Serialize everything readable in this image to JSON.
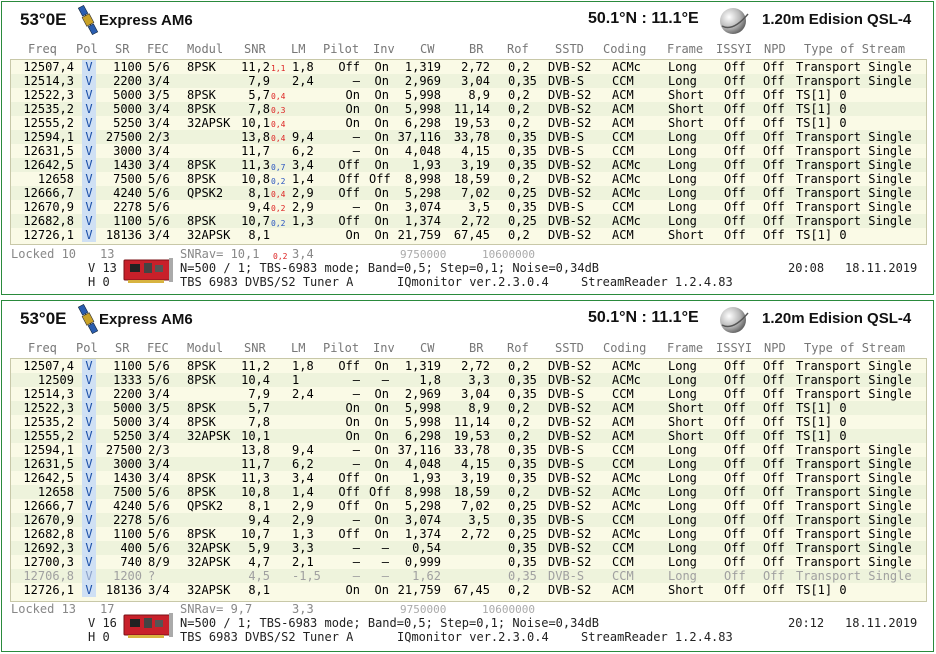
{
  "colors": {
    "border": "#2a8a3c",
    "table_bg": "#fafae6",
    "row_alt": "#eef3dc",
    "pol_bg": "#cfe0f4",
    "up_mark": "#d22222",
    "down_mark": "#2a55c0"
  },
  "icons": {
    "satellite": "satellite-icon",
    "globe": "globe-icon",
    "tuner_card": "tuner-card-icon"
  },
  "columns": [
    "Freq",
    "Pol",
    "SR",
    "FEC",
    "Modul",
    "SNR",
    "LM",
    "Pilot",
    "Inv",
    "CW",
    "BR",
    "Rof",
    "SSTD",
    "Coding",
    "Frame",
    "ISSYI",
    "NPD",
    "Type of Stream"
  ],
  "panels": [
    {
      "position": "53°0E",
      "satellite": "Express AM6",
      "location": "50.1°N : 11.1°E",
      "dish": "1.20m Edision QSL-4",
      "rows": [
        {
          "freq": "12507,4",
          "pol": "V",
          "sr": "1100",
          "fec": "5/6",
          "modul": "8PSK",
          "snr": "11,2",
          "mark": "1,1",
          "mdir": "up",
          "lm": "1,8",
          "pilot": "Off",
          "inv": "On",
          "cw": "1,319",
          "br": "2,72",
          "rof": "0,2",
          "sstd": "DVB-S2",
          "coding": "ACMc",
          "frame": "Long",
          "issyi": "Off",
          "npd": "Off",
          "type": "Transport Single"
        },
        {
          "freq": "12514,3",
          "pol": "V",
          "sr": "2200",
          "fec": "3/4",
          "modul": "",
          "snr": "7,9",
          "mark": "",
          "mdir": "",
          "lm": "2,4",
          "pilot": "–",
          "inv": "On",
          "cw": "2,969",
          "br": "3,04",
          "rof": "0,35",
          "sstd": "DVB-S",
          "coding": "CCM",
          "frame": "Long",
          "issyi": "Off",
          "npd": "Off",
          "type": "Transport Single"
        },
        {
          "freq": "12522,3",
          "pol": "V",
          "sr": "5000",
          "fec": "3/5",
          "modul": "8PSK",
          "snr": "5,7",
          "mark": "0,4",
          "mdir": "up",
          "lm": "",
          "pilot": "On",
          "inv": "On",
          "cw": "5,998",
          "br": "8,9",
          "rof": "0,2",
          "sstd": "DVB-S2",
          "coding": "ACM",
          "frame": "Short",
          "issyi": "Off",
          "npd": "Off",
          "type": "TS[1] 0"
        },
        {
          "freq": "12535,2",
          "pol": "V",
          "sr": "5000",
          "fec": "3/4",
          "modul": "8PSK",
          "snr": "7,8",
          "mark": "0,3",
          "mdir": "up",
          "lm": "",
          "pilot": "On",
          "inv": "On",
          "cw": "5,998",
          "br": "11,14",
          "rof": "0,2",
          "sstd": "DVB-S2",
          "coding": "ACM",
          "frame": "Short",
          "issyi": "Off",
          "npd": "Off",
          "type": "TS[1] 0"
        },
        {
          "freq": "12555,2",
          "pol": "V",
          "sr": "5250",
          "fec": "3/4",
          "modul": "32APSK",
          "snr": "10,1",
          "mark": "0,4",
          "mdir": "up",
          "lm": "",
          "pilot": "On",
          "inv": "On",
          "cw": "6,298",
          "br": "19,53",
          "rof": "0,2",
          "sstd": "DVB-S2",
          "coding": "ACM",
          "frame": "Short",
          "issyi": "Off",
          "npd": "Off",
          "type": "TS[1] 0"
        },
        {
          "freq": "12594,1",
          "pol": "V",
          "sr": "27500",
          "fec": "2/3",
          "modul": "",
          "snr": "13,8",
          "mark": "0,4",
          "mdir": "up",
          "lm": "9,4",
          "pilot": "–",
          "inv": "On",
          "cw": "37,116",
          "br": "33,78",
          "rof": "0,35",
          "sstd": "DVB-S",
          "coding": "CCM",
          "frame": "Long",
          "issyi": "Off",
          "npd": "Off",
          "type": "Transport Single"
        },
        {
          "freq": "12631,5",
          "pol": "V",
          "sr": "3000",
          "fec": "3/4",
          "modul": "",
          "snr": "11,7",
          "mark": "",
          "mdir": "",
          "lm": "6,2",
          "pilot": "–",
          "inv": "On",
          "cw": "4,048",
          "br": "4,15",
          "rof": "0,35",
          "sstd": "DVB-S",
          "coding": "CCM",
          "frame": "Long",
          "issyi": "Off",
          "npd": "Off",
          "type": "Transport Single"
        },
        {
          "freq": "12642,5",
          "pol": "V",
          "sr": "1430",
          "fec": "3/4",
          "modul": "8PSK",
          "snr": "11,3",
          "mark": "0,7",
          "mdir": "dn",
          "lm": "3,4",
          "pilot": "Off",
          "inv": "On",
          "cw": "1,93",
          "br": "3,19",
          "rof": "0,35",
          "sstd": "DVB-S2",
          "coding": "ACMc",
          "frame": "Long",
          "issyi": "Off",
          "npd": "Off",
          "type": "Transport Single"
        },
        {
          "freq": "12658",
          "pol": "V",
          "sr": "7500",
          "fec": "5/6",
          "modul": "8PSK",
          "snr": "10,8",
          "mark": "0,2",
          "mdir": "dn",
          "lm": "1,4",
          "pilot": "Off",
          "inv": "Off",
          "cw": "8,998",
          "br": "18,59",
          "rof": "0,2",
          "sstd": "DVB-S2",
          "coding": "ACMc",
          "frame": "Long",
          "issyi": "Off",
          "npd": "Off",
          "type": "Transport Single"
        },
        {
          "freq": "12666,7",
          "pol": "V",
          "sr": "4240",
          "fec": "5/6",
          "modul": "QPSK2",
          "snr": "8,1",
          "mark": "0,4",
          "mdir": "up",
          "lm": "2,9",
          "pilot": "Off",
          "inv": "On",
          "cw": "5,298",
          "br": "7,02",
          "rof": "0,25",
          "sstd": "DVB-S2",
          "coding": "ACMc",
          "frame": "Long",
          "issyi": "Off",
          "npd": "Off",
          "type": "Transport Single"
        },
        {
          "freq": "12670,9",
          "pol": "V",
          "sr": "2278",
          "fec": "5/6",
          "modul": "",
          "snr": "9,4",
          "mark": "0,2",
          "mdir": "up",
          "lm": "2,9",
          "pilot": "–",
          "inv": "On",
          "cw": "3,074",
          "br": "3,5",
          "rof": "0,35",
          "sstd": "DVB-S",
          "coding": "CCM",
          "frame": "Long",
          "issyi": "Off",
          "npd": "Off",
          "type": "Transport Single"
        },
        {
          "freq": "12682,8",
          "pol": "V",
          "sr": "1100",
          "fec": "5/6",
          "modul": "8PSK",
          "snr": "10,7",
          "mark": "0,2",
          "mdir": "dn",
          "lm": "1,3",
          "pilot": "Off",
          "inv": "On",
          "cw": "1,374",
          "br": "2,72",
          "rof": "0,25",
          "sstd": "DVB-S2",
          "coding": "ACMc",
          "frame": "Long",
          "issyi": "Off",
          "npd": "Off",
          "type": "Transport Single"
        },
        {
          "freq": "12726,1",
          "pol": "V",
          "sr": "18136",
          "fec": "3/4",
          "modul": "32APSK",
          "snr": "8,1",
          "mark": "",
          "mdir": "",
          "lm": "",
          "pilot": "On",
          "inv": "On",
          "cw": "21,759",
          "br": "67,45",
          "rof": "0,2",
          "sstd": "DVB-S2",
          "coding": "ACM",
          "frame": "Short",
          "issyi": "Off",
          "npd": "Off",
          "type": "TS[1] 0"
        }
      ],
      "footer": {
        "locked": "Locked 10",
        "count": "13",
        "snrav": "SNRav= 10,1",
        "snrav_mark": "0,2",
        "lmav": "3,4",
        "lof1": "9750000",
        "lof2": "10600000",
        "v_line": "V 13",
        "h_line": "H 0",
        "settings": "N=500 / 1; TBS-6983 mode; Band=0,5; Step=0,1; Noise=0,34dB",
        "time": "20:08",
        "date": "18.11.2019",
        "tuner": "TBS 6983 DVBS/S2 Tuner A",
        "iqmon": "IQmonitor ver.2.3.0.4",
        "reader": "StreamReader 1.2.4.83"
      }
    },
    {
      "position": "53°0E",
      "satellite": "Express AM6",
      "location": "50.1°N : 11.1°E",
      "dish": "1.20m Edision QSL-4",
      "rows": [
        {
          "freq": "12507,4",
          "pol": "V",
          "sr": "1100",
          "fec": "5/6",
          "modul": "8PSK",
          "snr": "11,2",
          "lm": "1,8",
          "pilot": "Off",
          "inv": "On",
          "cw": "1,319",
          "br": "2,72",
          "rof": "0,2",
          "sstd": "DVB-S2",
          "coding": "ACMc",
          "frame": "Long",
          "issyi": "Off",
          "npd": "Off",
          "type": "Transport Single"
        },
        {
          "freq": "12509",
          "pol": "V",
          "sr": "1333",
          "fec": "5/6",
          "modul": "8PSK",
          "snr": "10,4",
          "lm": "1",
          "pilot": "–",
          "inv": "–",
          "cw": "1,8",
          "br": "3,3",
          "rof": "0,35",
          "sstd": "DVB-S2",
          "coding": "ACMc",
          "frame": "Long",
          "issyi": "Off",
          "npd": "Off",
          "type": "Transport Single"
        },
        {
          "freq": "12514,3",
          "pol": "V",
          "sr": "2200",
          "fec": "3/4",
          "modul": "",
          "snr": "7,9",
          "lm": "2,4",
          "pilot": "–",
          "inv": "On",
          "cw": "2,969",
          "br": "3,04",
          "rof": "0,35",
          "sstd": "DVB-S",
          "coding": "CCM",
          "frame": "Long",
          "issyi": "Off",
          "npd": "Off",
          "type": "Transport Single"
        },
        {
          "freq": "12522,3",
          "pol": "V",
          "sr": "5000",
          "fec": "3/5",
          "modul": "8PSK",
          "snr": "5,7",
          "lm": "",
          "pilot": "On",
          "inv": "On",
          "cw": "5,998",
          "br": "8,9",
          "rof": "0,2",
          "sstd": "DVB-S2",
          "coding": "ACM",
          "frame": "Short",
          "issyi": "Off",
          "npd": "Off",
          "type": "TS[1] 0"
        },
        {
          "freq": "12535,2",
          "pol": "V",
          "sr": "5000",
          "fec": "3/4",
          "modul": "8PSK",
          "snr": "7,8",
          "lm": "",
          "pilot": "On",
          "inv": "On",
          "cw": "5,998",
          "br": "11,14",
          "rof": "0,2",
          "sstd": "DVB-S2",
          "coding": "ACM",
          "frame": "Short",
          "issyi": "Off",
          "npd": "Off",
          "type": "TS[1] 0"
        },
        {
          "freq": "12555,2",
          "pol": "V",
          "sr": "5250",
          "fec": "3/4",
          "modul": "32APSK",
          "snr": "10,1",
          "lm": "",
          "pilot": "On",
          "inv": "On",
          "cw": "6,298",
          "br": "19,53",
          "rof": "0,2",
          "sstd": "DVB-S2",
          "coding": "ACM",
          "frame": "Short",
          "issyi": "Off",
          "npd": "Off",
          "type": "TS[1] 0"
        },
        {
          "freq": "12594,1",
          "pol": "V",
          "sr": "27500",
          "fec": "2/3",
          "modul": "",
          "snr": "13,8",
          "lm": "9,4",
          "pilot": "–",
          "inv": "On",
          "cw": "37,116",
          "br": "33,78",
          "rof": "0,35",
          "sstd": "DVB-S",
          "coding": "CCM",
          "frame": "Long",
          "issyi": "Off",
          "npd": "Off",
          "type": "Transport Single"
        },
        {
          "freq": "12631,5",
          "pol": "V",
          "sr": "3000",
          "fec": "3/4",
          "modul": "",
          "snr": "11,7",
          "lm": "6,2",
          "pilot": "–",
          "inv": "On",
          "cw": "4,048",
          "br": "4,15",
          "rof": "0,35",
          "sstd": "DVB-S",
          "coding": "CCM",
          "frame": "Long",
          "issyi": "Off",
          "npd": "Off",
          "type": "Transport Single"
        },
        {
          "freq": "12642,5",
          "pol": "V",
          "sr": "1430",
          "fec": "3/4",
          "modul": "8PSK",
          "snr": "11,3",
          "lm": "3,4",
          "pilot": "Off",
          "inv": "On",
          "cw": "1,93",
          "br": "3,19",
          "rof": "0,35",
          "sstd": "DVB-S2",
          "coding": "ACMc",
          "frame": "Long",
          "issyi": "Off",
          "npd": "Off",
          "type": "Transport Single"
        },
        {
          "freq": "12658",
          "pol": "V",
          "sr": "7500",
          "fec": "5/6",
          "modul": "8PSK",
          "snr": "10,8",
          "lm": "1,4",
          "pilot": "Off",
          "inv": "Off",
          "cw": "8,998",
          "br": "18,59",
          "rof": "0,2",
          "sstd": "DVB-S2",
          "coding": "ACMc",
          "frame": "Long",
          "issyi": "Off",
          "npd": "Off",
          "type": "Transport Single"
        },
        {
          "freq": "12666,7",
          "pol": "V",
          "sr": "4240",
          "fec": "5/6",
          "modul": "QPSK2",
          "snr": "8,1",
          "lm": "2,9",
          "pilot": "Off",
          "inv": "On",
          "cw": "5,298",
          "br": "7,02",
          "rof": "0,25",
          "sstd": "DVB-S2",
          "coding": "ACMc",
          "frame": "Long",
          "issyi": "Off",
          "npd": "Off",
          "type": "Transport Single"
        },
        {
          "freq": "12670,9",
          "pol": "V",
          "sr": "2278",
          "fec": "5/6",
          "modul": "",
          "snr": "9,4",
          "lm": "2,9",
          "pilot": "–",
          "inv": "On",
          "cw": "3,074",
          "br": "3,5",
          "rof": "0,35",
          "sstd": "DVB-S",
          "coding": "CCM",
          "frame": "Long",
          "issyi": "Off",
          "npd": "Off",
          "type": "Transport Single"
        },
        {
          "freq": "12682,8",
          "pol": "V",
          "sr": "1100",
          "fec": "5/6",
          "modul": "8PSK",
          "snr": "10,7",
          "lm": "1,3",
          "pilot": "Off",
          "inv": "On",
          "cw": "1,374",
          "br": "2,72",
          "rof": "0,25",
          "sstd": "DVB-S2",
          "coding": "ACMc",
          "frame": "Long",
          "issyi": "Off",
          "npd": "Off",
          "type": "Transport Single"
        },
        {
          "freq": "12692,3",
          "pol": "V",
          "sr": "400",
          "fec": "5/6",
          "modul": "32APSK",
          "snr": "5,9",
          "lm": "3,3",
          "pilot": "–",
          "inv": "–",
          "cw": "0,54",
          "br": "",
          "rof": "0,35",
          "sstd": "DVB-S2",
          "coding": "CCM",
          "frame": "Long",
          "issyi": "Off",
          "npd": "Off",
          "type": "Transport Single"
        },
        {
          "freq": "12700,3",
          "pol": "V",
          "sr": "740",
          "fec": "8/9",
          "modul": "32APSK",
          "snr": "4,7",
          "lm": "2,1",
          "pilot": "–",
          "inv": "–",
          "cw": "0,999",
          "br": "",
          "rof": "0,35",
          "sstd": "DVB-S2",
          "coding": "CCM",
          "frame": "Long",
          "issyi": "Off",
          "npd": "Off",
          "type": "Transport Single"
        },
        {
          "freq": "12706,8",
          "pol": "V",
          "sr": "1200",
          "fec": "?",
          "modul": "",
          "snr": "4,5",
          "lm": "-1,5",
          "pilot": "–",
          "inv": "–",
          "cw": "1,62",
          "br": "",
          "rof": "0,35",
          "sstd": "DVB-S",
          "coding": "CCM",
          "frame": "Long",
          "issyi": "Off",
          "npd": "Off",
          "type": "Transport Single",
          "dim": true
        },
        {
          "freq": "12726,1",
          "pol": "V",
          "sr": "18136",
          "fec": "3/4",
          "modul": "32APSK",
          "snr": "8,1",
          "lm": "",
          "pilot": "On",
          "inv": "On",
          "cw": "21,759",
          "br": "67,45",
          "rof": "0,2",
          "sstd": "DVB-S2",
          "coding": "ACM",
          "frame": "Short",
          "issyi": "Off",
          "npd": "Off",
          "type": "TS[1] 0"
        }
      ],
      "footer": {
        "locked": "Locked 13",
        "count": "17",
        "snrav": "SNRav= 9,7",
        "snrav_mark": "",
        "lmav": "3,3",
        "lof1": "9750000",
        "lof2": "10600000",
        "v_line": "V 16",
        "h_line": "H 0",
        "settings": "N=500 / 1; TBS-6983 mode; Band=0,5; Step=0,1; Noise=0,34dB",
        "time": "20:12",
        "date": "18.11.2019",
        "tuner": "TBS 6983 DVBS/S2 Tuner A",
        "iqmon": "IQmonitor ver.2.3.0.4",
        "reader": "StreamReader 1.2.4.83"
      }
    }
  ]
}
